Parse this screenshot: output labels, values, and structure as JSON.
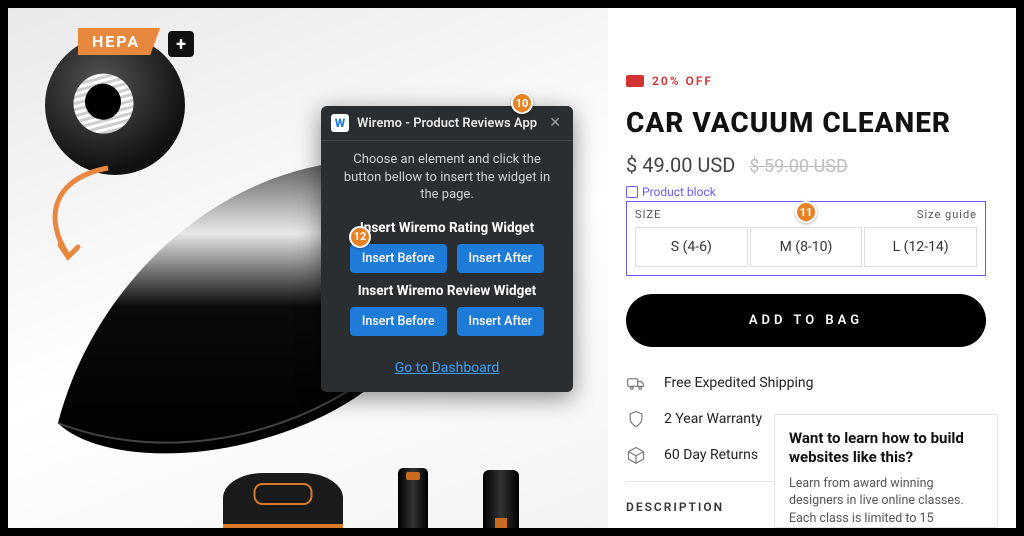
{
  "product": {
    "badge_text": "HEPA",
    "discount_label": "20% OFF",
    "title": "CAR VACUUM CLEANER",
    "price": "$ 49.00 USD",
    "price_old": "$ 59.00 USD",
    "block_label": "Product block",
    "size_header": "SIZE",
    "size_guide": "Size guide",
    "sizes": [
      "S  (4-6)",
      "M  (8-10)",
      "L  (12-14)"
    ],
    "add_to_bag": "ADD TO BAG",
    "features": [
      {
        "icon": "truck",
        "text": "Free Expedited Shipping"
      },
      {
        "icon": "shield",
        "text": "2 Year Warranty"
      },
      {
        "icon": "box",
        "text": "60 Day Returns"
      }
    ],
    "description_heading": "DESCRIPTION"
  },
  "promo": {
    "title": "Want to learn how to build websites like this?",
    "body": "Learn from award winning designers in live online classes. Each class is limited to 15"
  },
  "popup": {
    "app_name": "Wiremo - Product Reviews App",
    "instruction": "Choose an element and click the button bellow to insert the widget in the page.",
    "section_rating": "Insert Wiremo Rating Widget",
    "section_review": "Insert Wiremo Review Widget",
    "btn_before": "Insert Before",
    "btn_after": "Insert After",
    "dashboard": "Go to Dashboard"
  },
  "annotations": {
    "a10": "10",
    "a11": "11",
    "a12": "12"
  }
}
